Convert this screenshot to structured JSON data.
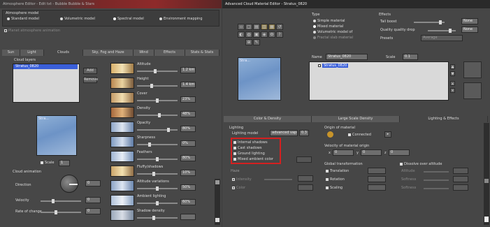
{
  "left": {
    "title": "Atmosphere Editor - Edit txt - Bubble Bubble & Stars",
    "atmo_model_label": "Atmosphere model",
    "models": [
      "Standard model",
      "Volumetric model",
      "Spectral model",
      "Environment mapping"
    ],
    "model_selected": 2,
    "planet_anim": "Planet atmosphere animation",
    "tabs": [
      "Sun",
      "Light",
      "Clouds",
      "Sky, Fog and Haze",
      "Wind",
      "Effects",
      "Stats & Stats"
    ],
    "active_tab": 2,
    "cloud_layers_label": "Cloud layers",
    "layer_item": "Stratus_0820",
    "add_btn": "Add",
    "remove_btn": "Remove",
    "preview_label": "Stra...",
    "scale_label": "Scale",
    "scale_value": "1",
    "cloud_anim_label": "Cloud animation",
    "direction_label": "Direction",
    "direction_value": "0",
    "velocity_label": "Velocity",
    "velocity_value": "0",
    "rate_change_label": "Rate of change",
    "rate_change_value": "0",
    "params": [
      {
        "name": "Altitude",
        "value": "1.2 km",
        "level": 0.45
      },
      {
        "name": "Height",
        "value": "1.4 km",
        "level": 0.35
      },
      {
        "name": "Cover",
        "value": "23%",
        "level": 0.5
      },
      {
        "name": "Density",
        "value": "48%",
        "level": 0.55
      },
      {
        "name": "Opacity",
        "value": "80%",
        "level": 0.8
      },
      {
        "name": "Sharpness",
        "value": "0%",
        "level": 0.3
      },
      {
        "name": "Feathers",
        "value": "80%",
        "level": 0.5
      },
      {
        "name": "Fluffy/shadows",
        "value": "10%",
        "level": 0.4
      },
      {
        "name": "Altitude variations",
        "value": "50%",
        "level": 0.5
      },
      {
        "name": "Ambient lighting",
        "value": "60%",
        "level": 0.5
      },
      {
        "name": "Shadow density",
        "value": "",
        "level": 0.4
      }
    ]
  },
  "right": {
    "title": "Advanced Cloud Material Editor - Stratus_0820",
    "type_label": "Type",
    "types": [
      "Simple material",
      "Mixed material",
      "Volumetric model of",
      "Fractal slab material"
    ],
    "type_selected": 1,
    "effects_label": "Effects",
    "tail_boost_label": "Tail boost",
    "tail_boost_value": "None",
    "quality_label": "Quality quality drop",
    "quality_value": "None",
    "presets_label": "Presets",
    "presets_value": "Average",
    "name_label": "Name",
    "name_value": "Stratus_0820",
    "scale_label": "Scale",
    "scale_value": "0.1",
    "layer_item": "Stratus_0820",
    "preview_label": "Stra...",
    "tabs": [
      "Color & Density",
      "Large Scale Density",
      "Lighting & Effects"
    ],
    "active_tab": 2,
    "lighting_label": "Lighting",
    "lighting_model_label": "Lighting model",
    "lighting_model_value": "advanced vaps",
    "lighting_model_extra": "0.3",
    "checkboxes": [
      "Internal shadows",
      "Cast shadows",
      "Ground lighting",
      "Mixed ambient color"
    ],
    "haze_label": "Haze",
    "haze_items": [
      "Intensity",
      "Color"
    ],
    "origin_label": "Origin of material",
    "origin_value": "Connected",
    "velocity_label": "Velocity of material origin",
    "velocity_values": [
      "0",
      "0",
      "0"
    ],
    "global_label": "Global transformation",
    "global_items": [
      "Translation",
      "Rotation",
      "Scaling"
    ],
    "dissolve_label": "Dissolve over altitude",
    "dissolve_items": [
      "Altitude",
      "Softness",
      "Softness"
    ]
  }
}
